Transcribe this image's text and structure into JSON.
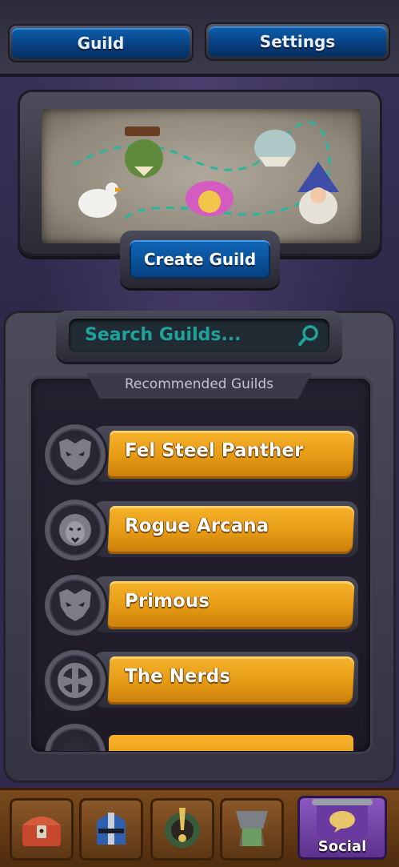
{
  "tabs": {
    "guild_label": "Guild",
    "settings_label": "Settings"
  },
  "guild_home": {
    "create_button_label": "Create Guild"
  },
  "search": {
    "placeholder": "Search Guilds..."
  },
  "recommended": {
    "heading": "Recommended Guilds",
    "guilds": [
      {
        "name": "Fel Steel Panther",
        "emblem": "panther-skull-icon"
      },
      {
        "name": "Rogue Arcana",
        "emblem": "lion-head-icon"
      },
      {
        "name": "Primous",
        "emblem": "panther-skull-icon"
      },
      {
        "name": "The Nerds",
        "emblem": "horde-crest-icon"
      }
    ]
  },
  "bottom_nav": {
    "items": [
      {
        "icon": "treasure-chest-icon"
      },
      {
        "icon": "knight-helmet-icon"
      },
      {
        "icon": "emblem-icon"
      },
      {
        "icon": "green-tower-icon"
      },
      {
        "icon": "social-scroll-icon",
        "label": "Social",
        "active": true
      }
    ]
  },
  "colors": {
    "tab_blue": "#0d5fae",
    "guild_bar_gold": "#e59a14",
    "search_text_teal": "#1fa29a",
    "social_purple": "#8d5ac4"
  }
}
